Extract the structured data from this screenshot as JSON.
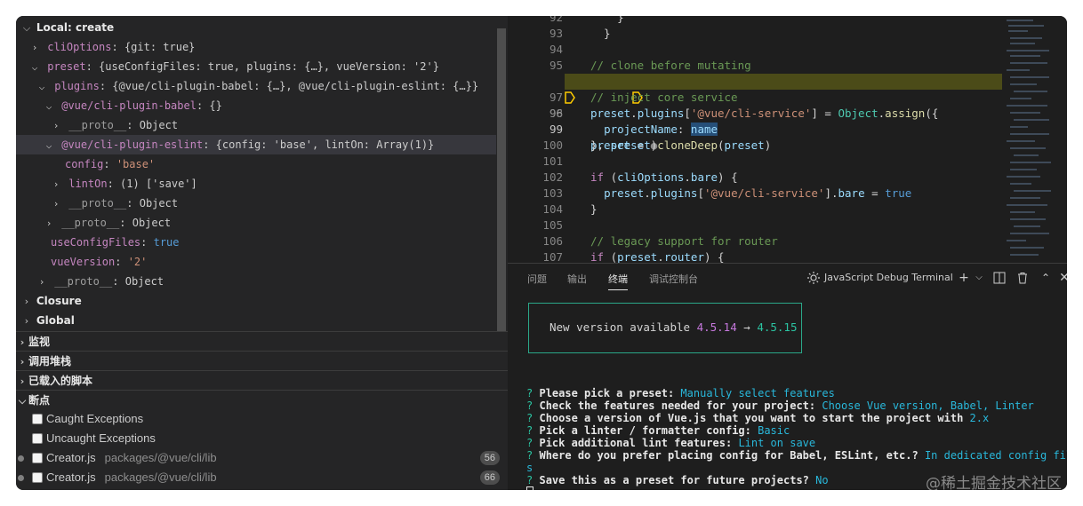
{
  "variables": {
    "local_header": "Local: create",
    "rows": [
      {
        "key": "cliOptions",
        "value": "{git: true}"
      },
      {
        "key": "preset",
        "value": "{useConfigFiles: true, plugins: {…}, vueVersion: '2'}"
      },
      {
        "key": "plugins",
        "value": "{@vue/cli-plugin-babel: {…}, @vue/cli-plugin-eslint: {…}}"
      },
      {
        "key": "@vue/cli-plugin-babel",
        "value": "{}"
      },
      {
        "key": "__proto__",
        "value": "Object"
      },
      {
        "key": "@vue/cli-plugin-eslint",
        "value": "{config: 'base', lintOn: Array(1)}"
      },
      {
        "key": "config",
        "value": "'base'"
      },
      {
        "key": "lintOn",
        "value": "(1) ['save']"
      },
      {
        "key": "__proto__",
        "value": "Object"
      },
      {
        "key": "__proto__",
        "value": "Object"
      },
      {
        "key": "useConfigFiles",
        "value": "true"
      },
      {
        "key": "vueVersion",
        "value": "'2'"
      },
      {
        "key": "__proto__",
        "value": "Object"
      }
    ],
    "closure": "Closure",
    "global": "Global"
  },
  "sections": {
    "watch": "监视",
    "call_stack": "调用堆栈",
    "loaded_scripts": "已载入的脚本",
    "breakpoints": "断点"
  },
  "breakpoints": [
    {
      "label": "Caught Exceptions"
    },
    {
      "label": "Uncaught Exceptions"
    },
    {
      "label": "Creator.js",
      "path": "packages/@vue/cli/lib",
      "line": "56"
    },
    {
      "label": "Creator.js",
      "path": "packages/@vue/cli/lib",
      "line": "66"
    }
  ],
  "editor": {
    "line_numbers": [
      "92",
      "93",
      "94",
      "95",
      "96",
      "97",
      "98",
      "99",
      "100",
      "101",
      "102",
      "103",
      "104",
      "105",
      "106",
      "107"
    ],
    "active_line": "96"
  },
  "terminal": {
    "tabs": [
      "问题",
      "输出",
      "终端",
      "调试控制台"
    ],
    "active_tab": "终端",
    "title": "JavaScript Debug Terminal",
    "update_prefix": "New version available ",
    "old_version": "4.5.14",
    "arrow": " → ",
    "new_version": "4.5.15",
    "prompts": [
      {
        "q": "Please pick a preset: ",
        "a": "Manually select features"
      },
      {
        "q": "Check the features needed for your project: ",
        "a": "Choose Vue version, Babel, Linter"
      },
      {
        "q": "Choose a version of Vue.js that you want to start the project with ",
        "a": "2.x"
      },
      {
        "q": "Pick a linter / formatter config: ",
        "a": "Basic"
      },
      {
        "q": "Pick additional lint features: ",
        "a": "Lint on save"
      },
      {
        "q": "Where do you prefer placing config for Babel, ESLint, etc.? ",
        "a": "In dedicated config file"
      },
      {
        "q": "",
        "a": "s"
      },
      {
        "q": "Save this as a preset for future projects? ",
        "a": "No"
      }
    ],
    "question_mark": "?"
  },
  "watermark": "@稀土掘金技术社区"
}
